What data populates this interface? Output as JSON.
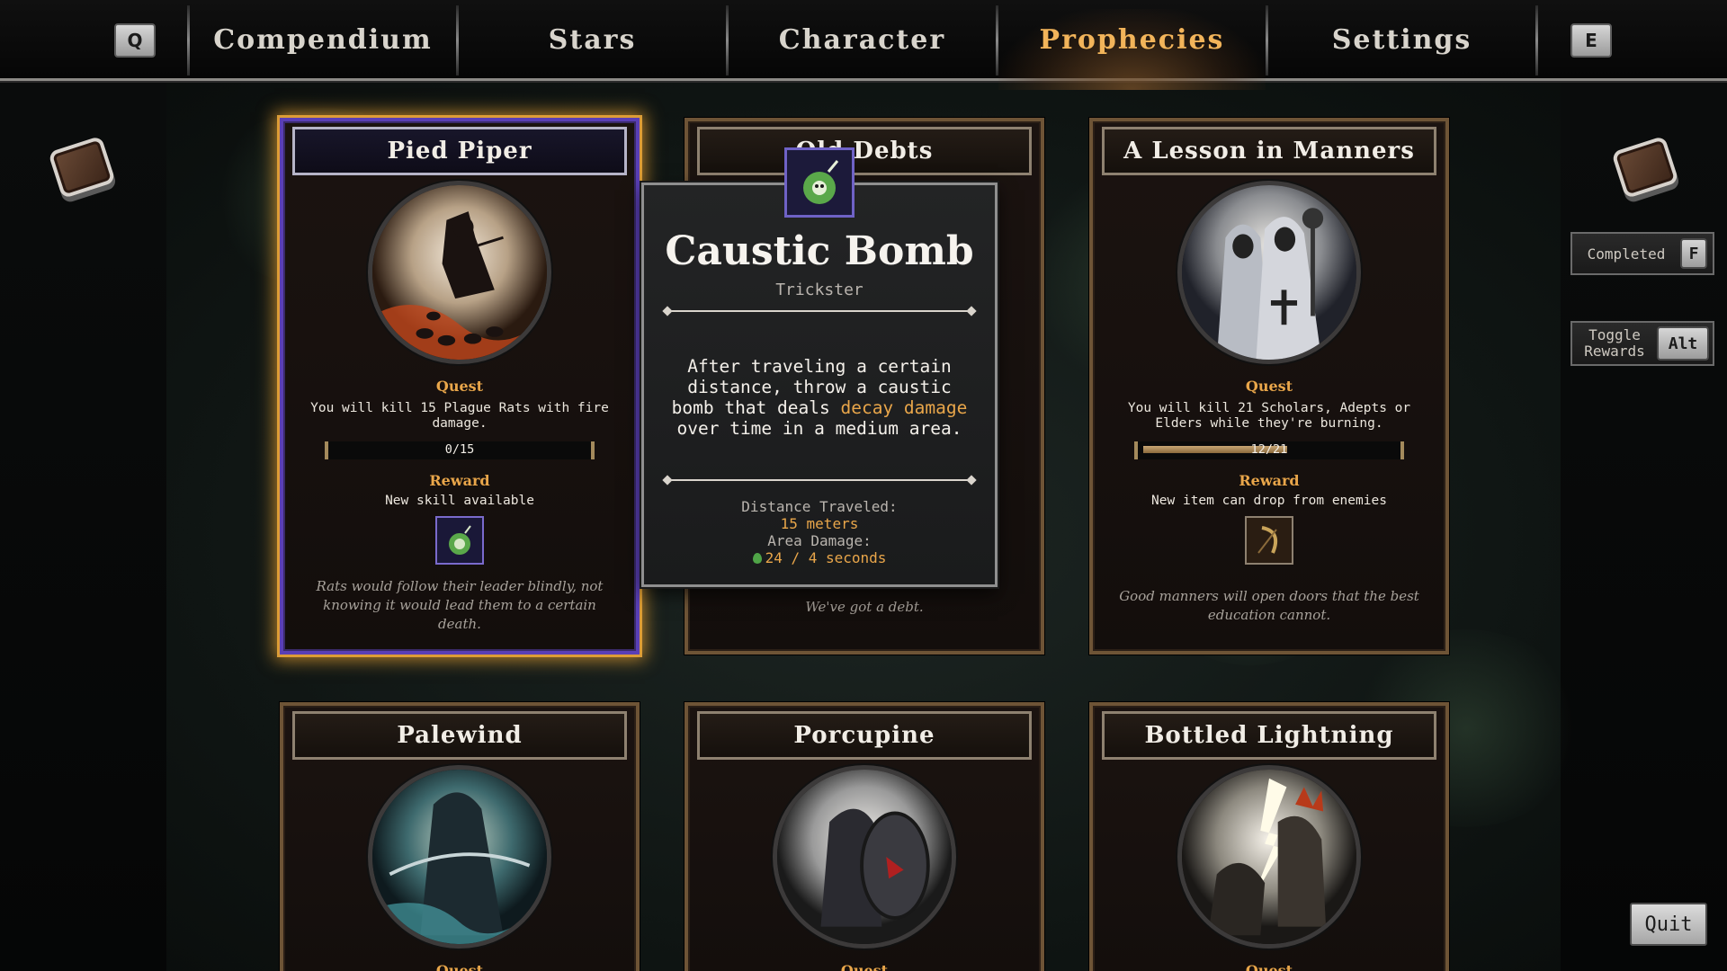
{
  "nav": {
    "left_key": "Q",
    "right_key": "E",
    "tabs": [
      {
        "label": "Compendium",
        "active": false
      },
      {
        "label": "Stars",
        "active": false
      },
      {
        "label": "Character",
        "active": false
      },
      {
        "label": "Prophecies",
        "active": true
      },
      {
        "label": "Settings",
        "active": false
      }
    ]
  },
  "side": {
    "completed_label": "Completed",
    "completed_key": "F",
    "toggle_label_line1": "Toggle",
    "toggle_label_line2": "Rewards",
    "toggle_key": "Alt",
    "quit_label": "Quit"
  },
  "cards": [
    {
      "title": "Pied Piper",
      "quest_label": "Quest",
      "quest_text": "You will kill 15 Plague Rats with fire damage.",
      "progress_text": "0/15",
      "progress_fraction": 0.0,
      "reward_label": "Reward",
      "reward_text": "New skill available",
      "flavor": "Rats would follow their leader blindly, not knowing it would lead them to a certain death.",
      "selected": true
    },
    {
      "title": "Old Debts",
      "flavor": "We've got a debt.",
      "selected": false
    },
    {
      "title": "A Lesson in Manners",
      "quest_label": "Quest",
      "quest_text": "You will kill 21 Scholars, Adepts or Elders while they're burning.",
      "progress_text": "12/21",
      "progress_fraction": 0.571,
      "reward_label": "Reward",
      "reward_text": "New item can drop from enemies",
      "flavor": "Good manners will open doors that the best education cannot.",
      "selected": false
    },
    {
      "title": "Palewind",
      "quest_label": "Quest"
    },
    {
      "title": "Porcupine",
      "quest_label": "Quest"
    },
    {
      "title": "Bottled Lightning",
      "quest_label": "Quest"
    }
  ],
  "tooltip": {
    "title": "Caustic Bomb",
    "subtitle": "Trickster",
    "desc_part1": "After traveling a certain distance, throw a caustic bomb that deals ",
    "desc_highlight": "decay damage",
    "desc_part2": " over time in a medium area.",
    "stat1_label": "Distance Traveled:",
    "stat1_value": "15 meters",
    "stat2_label": "Area Damage:",
    "stat2_value": "24 / 4 seconds",
    "highlight_color": "#e9a64a"
  }
}
